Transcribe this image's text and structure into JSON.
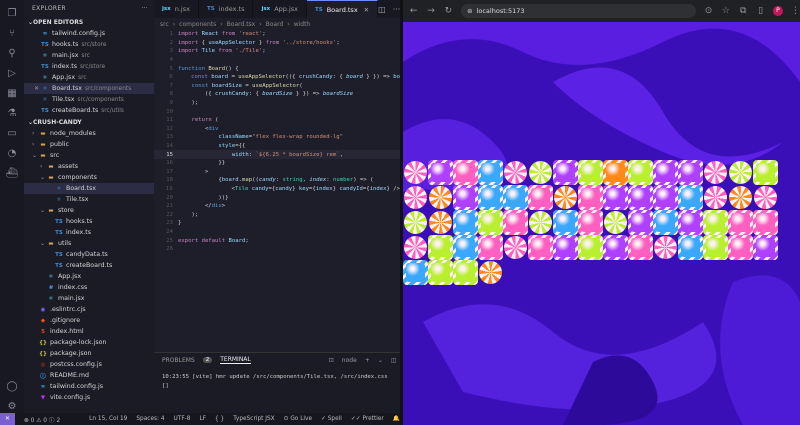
{
  "explorer": {
    "title": "EXPLORER",
    "more": "···"
  },
  "open_editors": {
    "label": "OPEN EDITORS",
    "items": [
      {
        "icon": "tailwind",
        "name": "tailwind.config.js",
        "desc": ""
      },
      {
        "icon": "ts",
        "name": "hooks.ts",
        "desc": "src/store"
      },
      {
        "icon": "jsx",
        "name": "main.jsx",
        "desc": "src"
      },
      {
        "icon": "ts",
        "name": "index.ts",
        "desc": "src/store"
      },
      {
        "icon": "jsx",
        "name": "App.jsx",
        "desc": "src"
      },
      {
        "icon": "tsx",
        "name": "Board.tsx",
        "desc": "src/components",
        "close": "✕"
      },
      {
        "icon": "tsx",
        "name": "Tile.tsx",
        "desc": "src/components"
      },
      {
        "icon": "ts",
        "name": "createBoard.ts",
        "desc": "src/utils"
      }
    ]
  },
  "project": {
    "label": "CRUSH-CANDY",
    "items": [
      {
        "indent": 1,
        "type": "folder",
        "name": "node_modules"
      },
      {
        "indent": 1,
        "type": "folder",
        "name": "public"
      },
      {
        "indent": 1,
        "type": "folder-open",
        "name": "src"
      },
      {
        "indent": 2,
        "type": "folder",
        "name": "assets"
      },
      {
        "indent": 2,
        "type": "folder-open",
        "name": "components"
      },
      {
        "indent": 3,
        "type": "tsx",
        "name": "Board.tsx",
        "selected": true
      },
      {
        "indent": 3,
        "type": "tsx",
        "name": "Tile.tsx"
      },
      {
        "indent": 2,
        "type": "folder-open",
        "name": "store"
      },
      {
        "indent": 3,
        "type": "ts",
        "name": "hooks.ts"
      },
      {
        "indent": 3,
        "type": "ts",
        "name": "index.ts"
      },
      {
        "indent": 2,
        "type": "folder-open",
        "name": "utils"
      },
      {
        "indent": 3,
        "type": "ts",
        "name": "candyData.ts"
      },
      {
        "indent": 3,
        "type": "ts",
        "name": "createBoard.ts"
      },
      {
        "indent": 2,
        "type": "jsx",
        "name": "App.jsx"
      },
      {
        "indent": 2,
        "type": "css",
        "name": "index.css"
      },
      {
        "indent": 2,
        "type": "jsx",
        "name": "main.jsx"
      },
      {
        "indent": 1,
        "type": "eslint",
        "name": ".eslintrc.cjs"
      },
      {
        "indent": 1,
        "type": "git",
        "name": ".gitignore"
      },
      {
        "indent": 1,
        "type": "html",
        "name": "index.html"
      },
      {
        "indent": 1,
        "type": "json",
        "name": "package-lock.json"
      },
      {
        "indent": 1,
        "type": "json",
        "name": "package.json"
      },
      {
        "indent": 1,
        "type": "postcss",
        "name": "postcss.config.js"
      },
      {
        "indent": 1,
        "type": "md",
        "name": "README.md"
      },
      {
        "indent": 1,
        "type": "tailwind",
        "name": "tailwind.config.js"
      },
      {
        "indent": 1,
        "type": "vite",
        "name": "vite.config.js"
      }
    ]
  },
  "tabs": [
    {
      "icon": "jsx",
      "label": "n.jsx",
      "active": false
    },
    {
      "icon": "TS",
      "label": "index.ts",
      "active": false
    },
    {
      "icon": "jsx",
      "label": "App.jsx",
      "active": false
    },
    {
      "icon": "TS",
      "label": "Board.tsx",
      "active": true,
      "close": "✕"
    }
  ],
  "breadcrumb": [
    "src",
    "components",
    "Board.tsx",
    "Board",
    "width"
  ],
  "code": [
    [
      [
        "kw",
        "import "
      ],
      [
        "vr",
        "React "
      ],
      [
        "kw",
        "from "
      ],
      [
        "st",
        "'react'"
      ],
      [
        "pl",
        ";"
      ]
    ],
    [
      [
        "kw",
        "import "
      ],
      [
        "pl",
        "{ "
      ],
      [
        "vr",
        "useAppSelector "
      ],
      [
        "pl",
        "} "
      ],
      [
        "kw",
        "from "
      ],
      [
        "st",
        "'../store/hooks'"
      ],
      [
        "pl",
        ";"
      ]
    ],
    [
      [
        "kw",
        "import "
      ],
      [
        "vr",
        "Tile "
      ],
      [
        "kw",
        "from "
      ],
      [
        "st",
        "'./Tile'"
      ],
      [
        "pl",
        ";"
      ]
    ],
    [],
    [
      [
        "tg",
        "function "
      ],
      [
        "fn",
        "Board"
      ],
      [
        "pl",
        "() {"
      ]
    ],
    [
      [
        "pl",
        "    "
      ],
      [
        "tg",
        "const "
      ],
      [
        "vr",
        "board "
      ],
      [
        "pl",
        "= "
      ],
      [
        "fn",
        "useAppSelector"
      ],
      [
        "pl",
        "(({ "
      ],
      [
        "vr",
        "crushCandy"
      ],
      [
        "pl",
        ": { "
      ],
      [
        "it",
        "board "
      ],
      [
        "pl",
        "} }) => "
      ],
      [
        "vr",
        "bo"
      ]
    ],
    [
      [
        "pl",
        "    "
      ],
      [
        "tg",
        "const "
      ],
      [
        "vr",
        "boardSize "
      ],
      [
        "pl",
        "= "
      ],
      [
        "fn",
        "useAppSelector"
      ],
      [
        "pl",
        "("
      ]
    ],
    [
      [
        "pl",
        "        ({ "
      ],
      [
        "vr",
        "crushCandy"
      ],
      [
        "pl",
        ": { "
      ],
      [
        "it",
        "boardSize "
      ],
      [
        "pl",
        "} }) => "
      ],
      [
        "it",
        "boardSize"
      ]
    ],
    [
      [
        "pl",
        "    );"
      ]
    ],
    [],
    [
      [
        "pl",
        "    "
      ],
      [
        "kw",
        "return "
      ],
      [
        "pl",
        "("
      ]
    ],
    [
      [
        "pl",
        "        <"
      ],
      [
        "tg",
        "div"
      ]
    ],
    [
      [
        "pl",
        "            "
      ],
      [
        "at",
        "className"
      ],
      [
        "pl",
        "="
      ],
      [
        "st",
        "\"flex flex-wrap rounded-lg\""
      ]
    ],
    [
      [
        "pl",
        "            "
      ],
      [
        "at",
        "style"
      ],
      [
        "pl",
        "={{"
      ]
    ],
    [
      [
        "pl",
        "                "
      ],
      [
        "vr",
        "width"
      ],
      [
        "pl",
        ": "
      ],
      [
        "st",
        "`${6.25 * boardSize} rem`"
      ],
      [
        "pl",
        ","
      ]
    ],
    [
      [
        "pl",
        "            }}"
      ]
    ],
    [
      [
        "pl",
        "        >"
      ]
    ],
    [
      [
        "pl",
        "            {"
      ],
      [
        "vr",
        "board"
      ],
      [
        "pl",
        "."
      ],
      [
        "fn",
        "map"
      ],
      [
        "pl",
        "(("
      ],
      [
        "it",
        "candy"
      ],
      [
        "pl",
        ": "
      ],
      [
        "ty",
        "string"
      ],
      [
        "pl",
        ", "
      ],
      [
        "it",
        "index"
      ],
      [
        "pl",
        ": "
      ],
      [
        "ty",
        "number"
      ],
      [
        "pl",
        ") => ("
      ]
    ],
    [
      [
        "pl",
        "                <"
      ],
      [
        "ty",
        "Tile "
      ],
      [
        "at",
        "candy"
      ],
      [
        "pl",
        "={"
      ],
      [
        "vr",
        "candy"
      ],
      [
        "pl",
        "} "
      ],
      [
        "at",
        "key"
      ],
      [
        "pl",
        "={"
      ],
      [
        "vr",
        "index"
      ],
      [
        "pl",
        "} "
      ],
      [
        "at",
        "candyId"
      ],
      [
        "pl",
        "={"
      ],
      [
        "vr",
        "index"
      ],
      [
        "pl",
        "} />"
      ]
    ],
    [
      [
        "pl",
        "            ))}"
      ]
    ],
    [
      [
        "pl",
        "        </"
      ],
      [
        "tg",
        "div"
      ],
      [
        "pl",
        ">"
      ]
    ],
    [
      [
        "pl",
        "    );"
      ]
    ],
    [
      [
        "pl",
        "}"
      ]
    ],
    [],
    [
      [
        "kw",
        "export default "
      ],
      [
        "vr",
        "Board"
      ],
      [
        "pl",
        ";"
      ]
    ],
    []
  ],
  "current_line": 15,
  "panel": {
    "problems_label": "PROBLEMS",
    "problems_count": "2",
    "terminal_label": "TERMINAL",
    "shell": "node",
    "terminal_line": "10:23:55 [vite] hmr update /src/components/Tile.tsx, /src/index.css",
    "prompt": "[]"
  },
  "status": {
    "remote": "✕",
    "errors": "0",
    "warnings": "0",
    "info": "2",
    "position": "Ln 15, Col 19",
    "spaces": "Spaces: 4",
    "encoding": "UTF-8",
    "eol": "LF",
    "braces": "{ }",
    "language": "TypeScript JSX",
    "golive": "Go Live",
    "spell": "Spell",
    "prettier": "Prettier"
  },
  "browser": {
    "url": "localhost:5173",
    "profile": "P"
  },
  "board_rows": [
    [
      "pink-swirl",
      "purple-gem",
      "pink-gem",
      "blue-gem",
      "pink-swirl",
      "lime-swirl",
      "purple-gem",
      "lime-gem",
      "orange-gem",
      "lime-gem",
      "purple-gem",
      "purple-gem",
      "pink-swirl",
      "lime-swirl",
      "lime-gem"
    ],
    [
      "pink-swirl",
      "orange-swirl",
      "purple-gem",
      "blue-gem",
      "blue-gem",
      "pink-gem",
      "orange-swirl",
      "pink-gem",
      "purple-gem",
      "purple-gem",
      "purple-gem",
      "blue-gem",
      "pink-swirl",
      "orange-swirl",
      "pink-swirl"
    ],
    [
      "lime-swirl",
      "orange-swirl",
      "blue-gem",
      "lime-gem",
      "pink-gem",
      "lime-swirl",
      "blue-gem",
      "pink-gem",
      "lime-swirl",
      "purple-gem",
      "blue-gem",
      "purple-gem",
      "lime-gem",
      "pink-gem",
      "pink-gem"
    ],
    [
      "pink-swirl",
      "lime-gem",
      "blue-gem",
      "pink-gem",
      "pink-swirl",
      "pink-gem",
      "purple-gem",
      "lime-gem",
      "purple-gem",
      "pink-gem",
      "pink-swirl",
      "blue-gem",
      "lime-gem",
      "pink-gem",
      "purple-gem"
    ],
    [
      "blue-gem",
      "lime-gem",
      "lime-gem",
      "orange-swirl"
    ]
  ],
  "candy_colors": {
    "pink": "#ff5fc0",
    "purple": "#b040ff",
    "blue": "#3aa8ff",
    "lime": "#b8f030",
    "orange": "#ff8a1a",
    "cream": "#fff0f6"
  }
}
